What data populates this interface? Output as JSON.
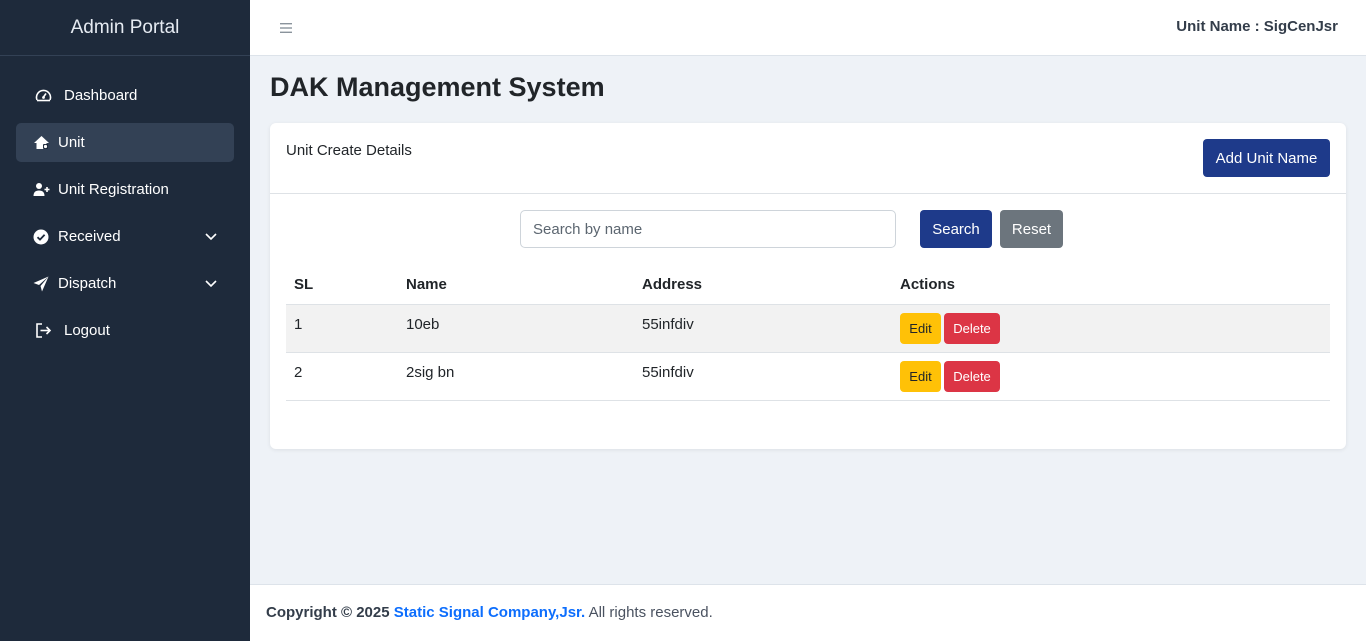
{
  "sidebar": {
    "brand": "Admin Portal",
    "items": [
      {
        "label": "Dashboard",
        "icon": "gauge-icon"
      },
      {
        "label": "Unit",
        "icon": "home-icon"
      },
      {
        "label": "Unit Registration",
        "icon": "user-plus-icon"
      },
      {
        "label": "Received",
        "icon": "check-circle-icon"
      },
      {
        "label": "Dispatch",
        "icon": "paper-plane-icon"
      },
      {
        "label": "Logout",
        "icon": "logout-icon"
      }
    ]
  },
  "topbar": {
    "unit_name": "Unit Name : SigCenJsr"
  },
  "main": {
    "page_title": "DAK Management System",
    "card": {
      "title": "Unit Create Details",
      "add_button": "Add Unit Name",
      "search_placeholder": "Search by name",
      "search_button": "Search",
      "reset_button": "Reset",
      "table": {
        "headers": [
          "SL",
          "Name",
          "Address",
          "Actions"
        ],
        "rows": [
          {
            "sl": "1",
            "name": "10eb",
            "address": "55infdiv",
            "edit": "Edit",
            "delete": "Delete"
          },
          {
            "sl": "2",
            "name": "2sig bn",
            "address": "55infdiv",
            "edit": "Edit",
            "delete": "Delete"
          }
        ]
      }
    }
  },
  "footer": {
    "copyright": "Copyright © 2025",
    "company": "Static Signal Company,Jsr.",
    "suffix": "All rights reserved."
  },
  "colors": {
    "sidebar_bg": "#1e2a3b",
    "primary": "#1e3a8a",
    "secondary": "#6c757d",
    "warning": "#ffc107",
    "danger": "#dc3545",
    "link": "#0d6efd"
  }
}
